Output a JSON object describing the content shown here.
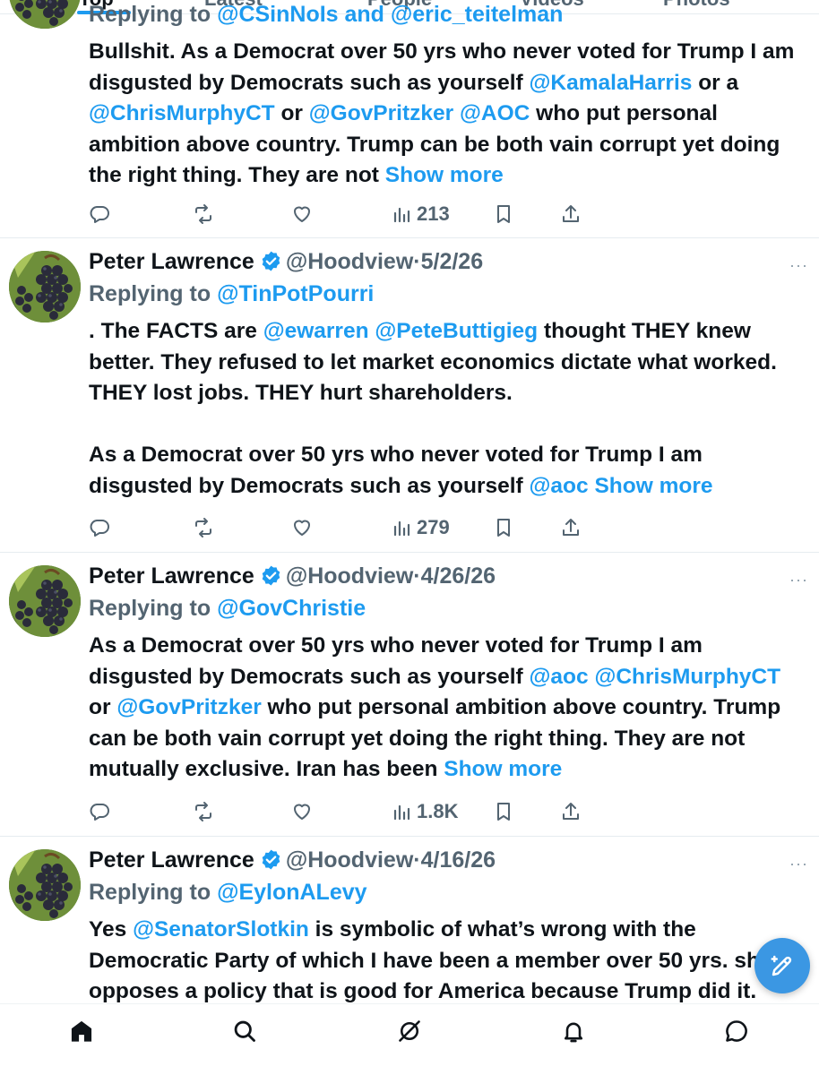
{
  "tabs": [
    {
      "label": "Top"
    },
    {
      "label": "Latest"
    },
    {
      "label": "People"
    },
    {
      "label": "Videos"
    },
    {
      "label": "Photos"
    }
  ],
  "tweets": [
    {
      "reply_prefix": "Replying to ",
      "reply_to": "@CSinNoIs and @eric_teitelman",
      "body": [
        {
          "t": "Bullshit. As a Democrat over 50 yrs who never voted for Trump I am disgusted by Democrats such as yourself "
        },
        {
          "m": "@KamalaHarris"
        },
        {
          "t": " or a "
        },
        {
          "m": "@ChrisMurphyCT"
        },
        {
          "t": " or "
        },
        {
          "m": "@GovPritzker"
        },
        {
          "t": "  "
        },
        {
          "m": "@AOC"
        },
        {
          "t": " who put personal ambition above country. Trump can be both vain corrupt yet doing the right thing. They are not "
        }
      ],
      "show_more": "Show more",
      "views": "213"
    },
    {
      "name": "Peter Lawrence",
      "handle": "@Hoodview",
      "dot": "·",
      "date": "5/2/26",
      "reply_prefix": "Replying to ",
      "reply_to": "@TinPotPourri",
      "body": [
        {
          "t": ". The FACTS are "
        },
        {
          "m": "@ewarren"
        },
        {
          "t": " "
        },
        {
          "m": "@PeteButtigieg"
        },
        {
          "t": " thought THEY knew better. They refused to let market economics dictate what worked. THEY lost jobs. THEY hurt shareholders."
        },
        {
          "br": 2
        },
        {
          "t": "As a Democrat over 50 yrs who never voted for Trump I am disgusted by Democrats such as yourself  "
        },
        {
          "m": "@aoc"
        },
        {
          "t": " "
        }
      ],
      "show_more": "Show more",
      "views": "279"
    },
    {
      "name": "Peter Lawrence",
      "handle": "@Hoodview",
      "dot": "·",
      "date": "4/26/26",
      "reply_prefix": "Replying to ",
      "reply_to": "@GovChristie",
      "body": [
        {
          "t": "As a Democrat over 50 yrs who never voted for Trump I am disgusted by Democrats such as yourself  "
        },
        {
          "m": "@aoc"
        },
        {
          "t": " "
        },
        {
          "m": "@ChrisMurphyCT"
        },
        {
          "t": " or "
        },
        {
          "m": "@GovPritzker"
        },
        {
          "t": " who put personal ambition above country. Trump can be both vain corrupt yet doing the right thing. They are not mutually exclusive. Iran has been "
        }
      ],
      "show_more": "Show more",
      "views": "1.8K"
    },
    {
      "name": "Peter Lawrence",
      "handle": "@Hoodview",
      "dot": "·",
      "date": "4/16/26",
      "reply_prefix": "Replying to ",
      "reply_to": "@EylonALevy",
      "body": [
        {
          "t": "Yes "
        },
        {
          "m": "@SenatorSlotkin"
        },
        {
          "t": " is symbolic of what’s wrong with the Democratic Party of which I have been a member over 50 yrs. she opposes a policy that is good for America because Trump did it."
        }
      ]
    }
  ],
  "icons": {
    "reply": "reply-icon",
    "repost": "repost-icon",
    "like": "heart-icon",
    "views": "views-icon",
    "bookmark": "bookmark-icon",
    "share": "share-icon",
    "compose": "compose-icon",
    "more": "more-icon",
    "home": "home-icon",
    "search": "search-icon",
    "grok": "grok-icon",
    "notifications": "bell-icon",
    "messages": "messages-icon"
  },
  "colors": {
    "accent": "#1d9bf0",
    "secondary_text": "#536471",
    "primary_text": "#0f1419",
    "fab": "#3b97e3"
  }
}
